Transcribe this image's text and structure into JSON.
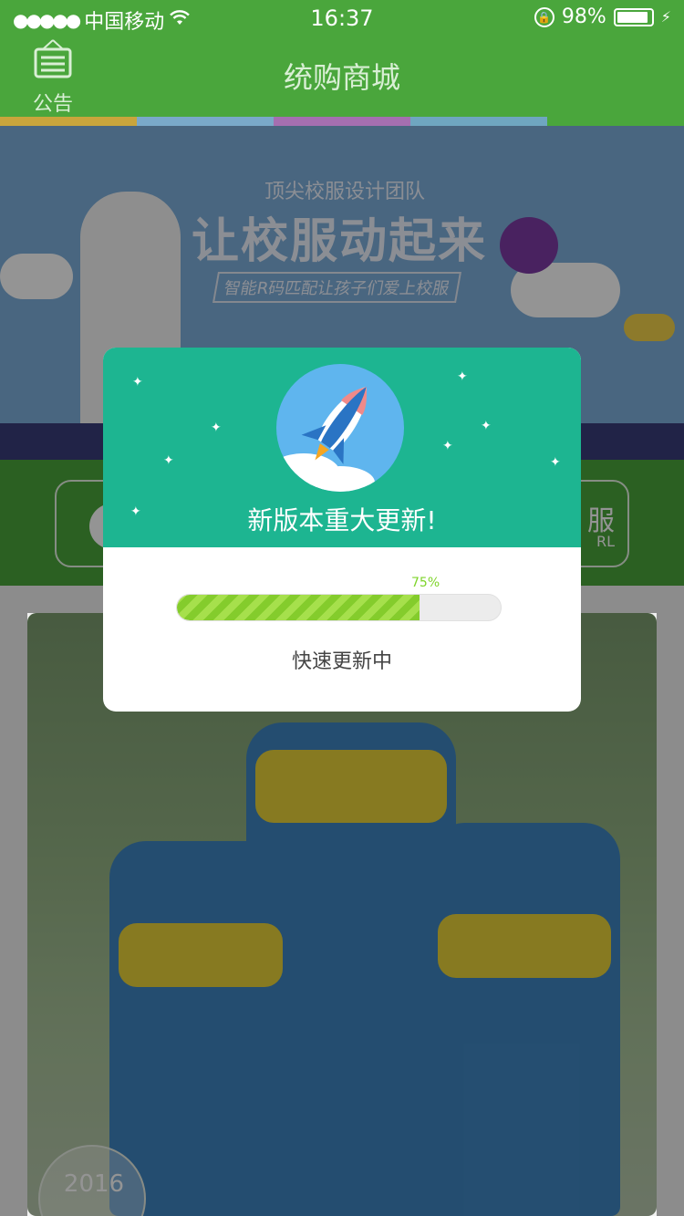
{
  "status_bar": {
    "signal_dots": "●●●●●",
    "carrier": "中国移动",
    "wifi_icon": "wifi-icon",
    "time": "16:37",
    "lock_icon": "rotation-lock-icon",
    "battery_percent": "98%",
    "battery_level": 0.98
  },
  "navbar": {
    "title": "统购商城",
    "notice_label": "公告"
  },
  "banner": {
    "subtitle": "顶尖校服设计团队",
    "headline": "让校服动起来",
    "tagline": "智能R码匹配让孩子们爱上校服"
  },
  "category_row": {
    "right_label": "服",
    "right_sub": "RL"
  },
  "product": {
    "year_badge": "2016"
  },
  "update_modal": {
    "title": "新版本重大更新!",
    "progress_label": "75%",
    "progress_value": 0.75,
    "status_text": "快速更新中"
  },
  "colors": {
    "brand_green": "#4aa63c",
    "modal_teal": "#1db591",
    "progress_green": "#84cc2c"
  }
}
